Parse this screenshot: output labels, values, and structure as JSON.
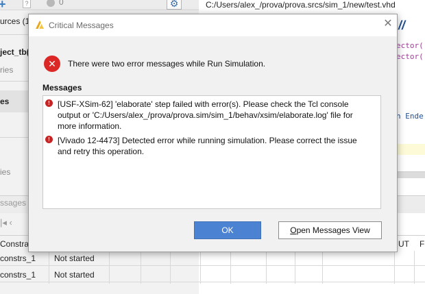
{
  "background": {
    "toolbar": {
      "count": "0"
    },
    "left_panel": {
      "sources_fragment": "urces (1",
      "testbench_fragment": "ject_tb(",
      "ies_fragment_1": "ries",
      "es_fragment": "es",
      "ies_fragment_2": "ies"
    },
    "editor": {
      "file_path": "C:/Users/alex_/prova/prova.srcs/sim_1/new/test.vhd",
      "code_fragment_1": "ector(",
      "code_fragment_2": "ector(",
      "code_fragment_3": "n Ende"
    },
    "messages_panel": {
      "tab_fragment": "ssages",
      "constraints_header": "Constra",
      "ut_header": "UT",
      "f_header": "F",
      "rows": [
        {
          "name": "constrs_1",
          "status": "Not started"
        },
        {
          "name": "constrs_1",
          "status": "Not started"
        }
      ]
    }
  },
  "dialog": {
    "title": "Critical Messages",
    "headline": "There were two error messages while Run Simulation.",
    "messages_label": "Messages",
    "messages": [
      {
        "lines": [
          "[USF-XSim-62] 'elaborate' step failed with error(s). Please check the Tcl console",
          "output or 'C:/Users/alex_/prova/prova.sim/sim_1/behav/xsim/elaborate.log' file for",
          "more information."
        ]
      },
      {
        "lines": [
          "[Vivado 12-4473] Detected error while running simulation. Please correct the issue",
          "and retry this operation."
        ]
      }
    ],
    "ok_label": "OK",
    "open_view_first_letter": "O",
    "open_view_rest": "pen Messages View"
  },
  "colors": {
    "ok_button": "#4b82d1",
    "error_red": "#dc2727",
    "dialog_bg": "#f1f1f1"
  },
  "icons": [
    "plus-icon",
    "help-icon",
    "status-dot-icon",
    "gear-icon",
    "vivado-logo-icon",
    "close-icon",
    "error-icon",
    "error-bullet-icon"
  ]
}
